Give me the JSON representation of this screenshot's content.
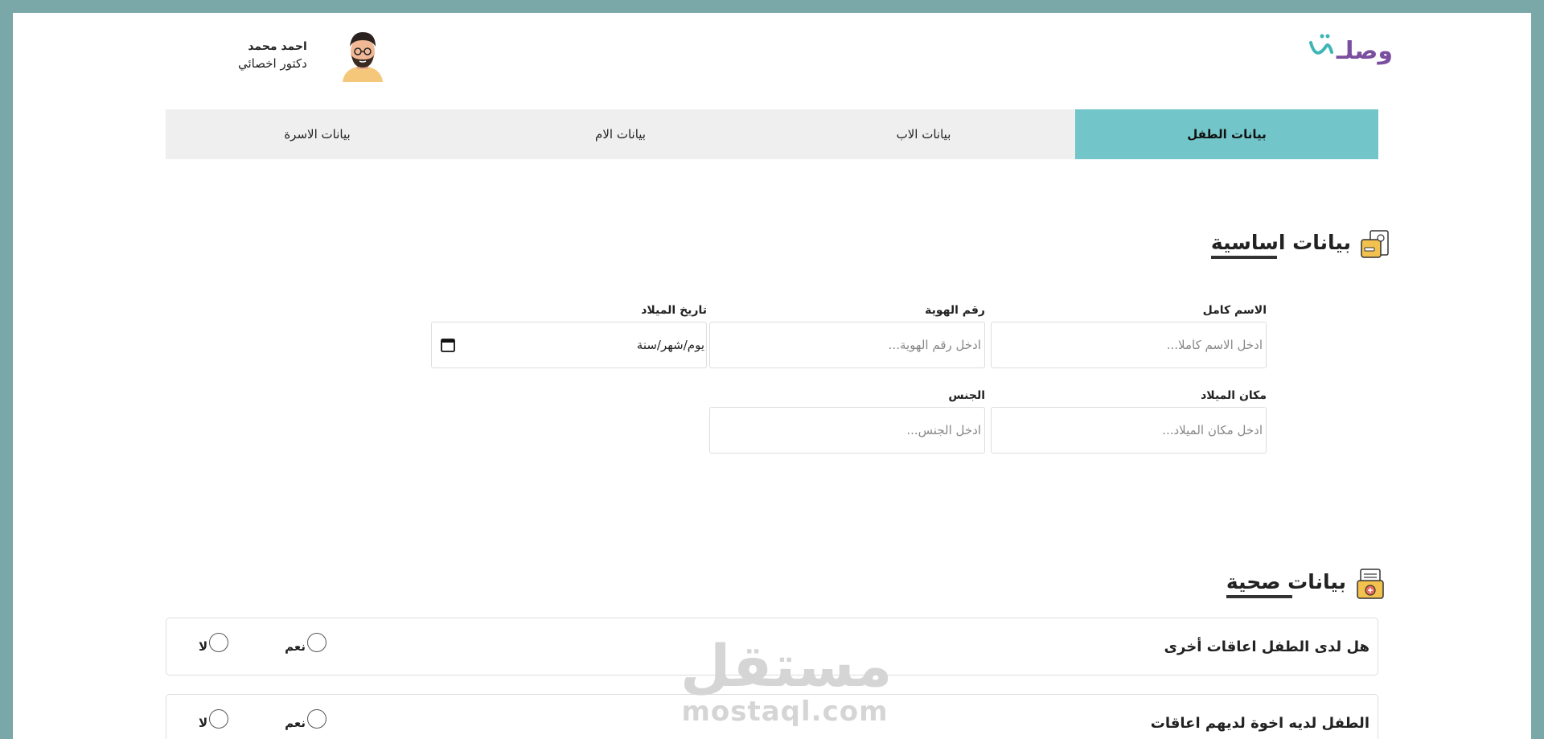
{
  "header": {
    "logo_text": "وصلـ",
    "user": {
      "name": "احمد محمد",
      "role": "دكتور اخصائي"
    }
  },
  "tabs": [
    {
      "label": "بيانات الطفل",
      "active": true
    },
    {
      "label": "بيانات الاب",
      "active": false
    },
    {
      "label": "بيانات الام",
      "active": false
    },
    {
      "label": "بيانات الاسرة",
      "active": false
    }
  ],
  "basic_section": {
    "title": "بيانات اساسية",
    "fields": {
      "full_name": {
        "label": "الاسم كامل",
        "placeholder": "ادخل الاسم كاملا..."
      },
      "id_number": {
        "label": "رقم الهوية",
        "placeholder": "ادخل رقم الهوية..."
      },
      "birth_date": {
        "label": "تاريخ الميلاد",
        "value": "يوم/شهر/سنة"
      },
      "birth_place": {
        "label": "مكان الميلاد",
        "placeholder": "ادخل مكان الميلاد..."
      },
      "gender": {
        "label": "الجنس",
        "placeholder": "ادخل الجنس..."
      }
    }
  },
  "health_section": {
    "title": "بيانات صحية",
    "questions": [
      {
        "text": "هل لدى الطفل اعاقات أخرى",
        "yes": "نعم",
        "no": "لا"
      },
      {
        "text": "الطفل لديه اخوة لديهم اعاقات",
        "yes": "نعم",
        "no": "لا"
      }
    ]
  },
  "watermark": {
    "arabic": "مستقل",
    "latin": "mostaql.com"
  },
  "colors": {
    "frame": "#7aa7a8",
    "active_tab": "#72c5c8",
    "tab_bg": "#efefef",
    "logo_purple": "#7b4fa0",
    "logo_teal": "#3fb5b8"
  }
}
